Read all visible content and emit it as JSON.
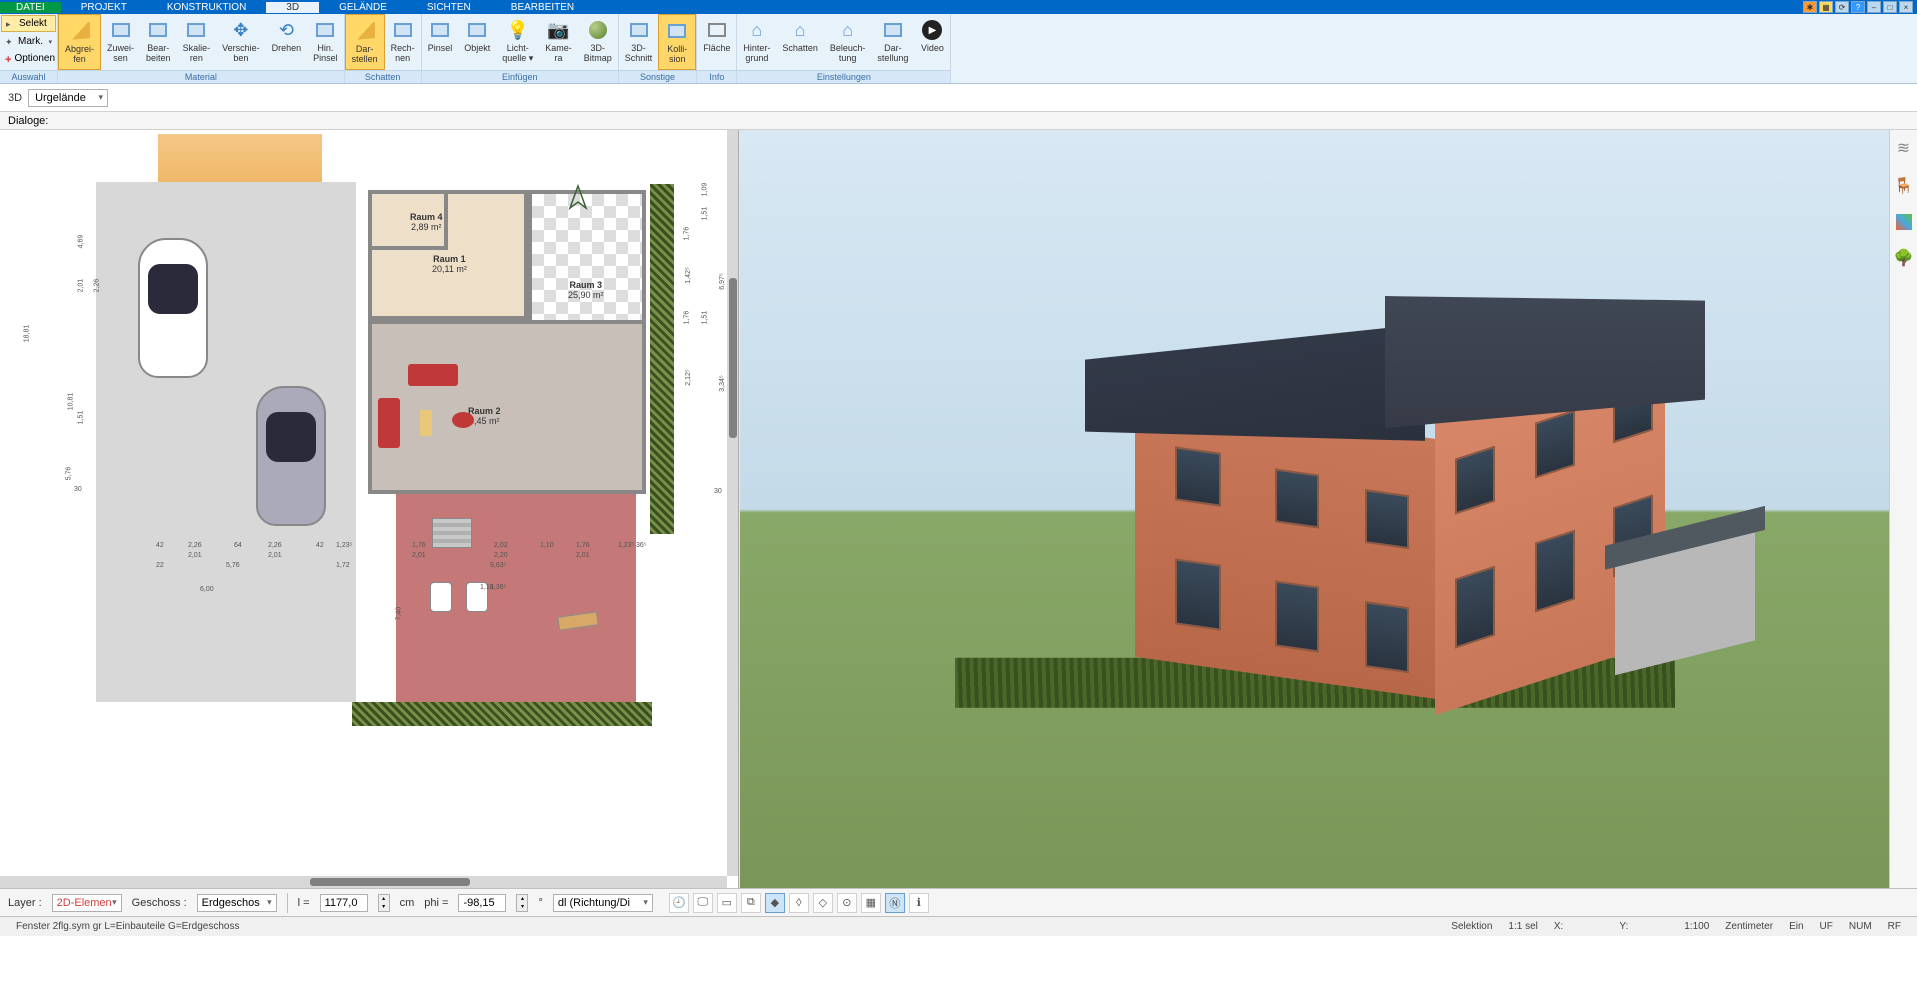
{
  "menu": {
    "tabs": [
      "DATEI",
      "PROJEKT",
      "KONSTRUKTION",
      "3D",
      "GELÄNDE",
      "SICHTEN",
      "BEARBEITEN"
    ],
    "active_index": 3
  },
  "ribbon_left": {
    "selekt": "Selekt",
    "mark": "Mark.",
    "optionen": "Optionen",
    "group": "Auswahl"
  },
  "ribbon_groups": [
    {
      "name": "Material",
      "buttons": [
        {
          "id": "abgreifen",
          "line1": "Abgrei-",
          "line2": "fen",
          "icon": "cube",
          "active": true
        },
        {
          "id": "zuweisen",
          "line1": "Zuwei-",
          "line2": "sen",
          "icon": "box"
        },
        {
          "id": "bearbeiten",
          "line1": "Bear-",
          "line2": "beiten",
          "icon": "box"
        },
        {
          "id": "skalieren",
          "line1": "Skalie-",
          "line2": "ren",
          "icon": "box"
        },
        {
          "id": "verschieben",
          "line1": "Verschie-",
          "line2": "ben",
          "icon": "arrows"
        },
        {
          "id": "drehen",
          "line1": "Drehen",
          "line2": "",
          "icon": "rotate"
        },
        {
          "id": "hinpinsel",
          "line1": "Hin.",
          "line2": "Pinsel",
          "icon": "box"
        }
      ]
    },
    {
      "name": "Schatten",
      "buttons": [
        {
          "id": "darstellen",
          "line1": "Dar-",
          "line2": "stellen",
          "icon": "cube",
          "active": true
        },
        {
          "id": "rechnen",
          "line1": "Rech-",
          "line2": "nen",
          "icon": "box"
        }
      ]
    },
    {
      "name": "Einfügen",
      "buttons": [
        {
          "id": "pinsel",
          "line1": "Pinsel",
          "line2": "",
          "icon": "box"
        },
        {
          "id": "objekt",
          "line1": "Objekt",
          "line2": "",
          "icon": "box"
        },
        {
          "id": "licht",
          "line1": "Licht-",
          "line2": "quelle ▾",
          "icon": "light"
        },
        {
          "id": "kamera",
          "line1": "Kame-",
          "line2": "ra",
          "icon": "camera"
        },
        {
          "id": "bitmap",
          "line1": "3D-",
          "line2": "Bitmap",
          "icon": "sphere"
        }
      ]
    },
    {
      "name": "Sonstige",
      "buttons": [
        {
          "id": "schnitt",
          "line1": "3D-",
          "line2": "Schnitt",
          "icon": "box"
        },
        {
          "id": "kollision",
          "line1": "Kolli-",
          "line2": "sion",
          "icon": "box",
          "active": true
        }
      ]
    },
    {
      "name": "Info",
      "buttons": [
        {
          "id": "flaeche",
          "line1": "Fläche",
          "line2": "",
          "icon": "rect"
        }
      ]
    },
    {
      "name": "Einstellungen",
      "buttons": [
        {
          "id": "hintergrund",
          "line1": "Hinter-",
          "line2": "grund",
          "icon": "house"
        },
        {
          "id": "schatten2",
          "line1": "Schatten",
          "line2": "",
          "icon": "house"
        },
        {
          "id": "beleuchtung",
          "line1": "Beleuch-",
          "line2": "tung",
          "icon": "house"
        },
        {
          "id": "darstellung",
          "line1": "Dar-",
          "line2": "stellung",
          "icon": "box"
        },
        {
          "id": "video",
          "line1": "Video",
          "line2": "",
          "icon": "play"
        }
      ]
    }
  ],
  "subribbon": {
    "label_3d": "3D",
    "terrain_selected": "Urgelände"
  },
  "dialog_label": "Dialoge:",
  "rooms": {
    "r1": {
      "name": "Raum 1",
      "area": "20,11 m²"
    },
    "r2": {
      "name": "Raum 2",
      "area": "6,45 m²"
    },
    "r3": {
      "name": "Raum 3",
      "area": "25,90 m²"
    },
    "r4": {
      "name": "Raum 4",
      "area": "2,89 m²"
    }
  },
  "dimensions": {
    "d_left_total": "18,81",
    "d_left_a": "10,81",
    "d_left_b": "5,76",
    "d_h1": "4,69",
    "d_h2": "2,01",
    "d_h2b": "2,26",
    "d_h3": "1,51",
    "d_h4": "30",
    "d_bot_a": "42",
    "d_bot_b": "2,26",
    "d_bot_b2": "2,01",
    "d_bot_c": "64",
    "d_bot_d": "2,26",
    "d_bot_d2": "2,01",
    "d_bot_e": "42",
    "d_bot_f": "1,23⁵",
    "d_bot_inner1": "22",
    "d_bot_inner2": "5,76",
    "d_bot_inner3": "1,72",
    "d_bot_total": "6,00",
    "d_lower_a": "1,76",
    "d_lower_a2": "2,01",
    "d_lower_b": "2,02",
    "d_lower_b2": "2,20",
    "d_lower_c": "1,10",
    "d_lower_d": "1,76",
    "d_lower_d2": "2,01",
    "d_lower_e": "1,23⁵",
    "d_lower_total": "9,63⁵",
    "d_lower_sub1": "1,10",
    "d_lower_sub2": "1,36⁵",
    "d_lower_left": "7,40",
    "d_right_a": "1,76",
    "d_right_b": "1,42⁵",
    "d_right_c": "1,76",
    "d_right_d": "1,51",
    "d_right_d2": "1,51",
    "d_right_e": "2,12⁵",
    "d_right_e2": "1,09",
    "d_right_total": "6,97⁵",
    "d_right_total2": "3,34⁵",
    "d_right_end": "30",
    "d_right_end2": "36⁵"
  },
  "bottombar": {
    "layer_label": "Layer :",
    "layer_value": "2D-Elemen",
    "geschoss_label": "Geschoss :",
    "geschoss_value": "Erdgeschos",
    "l_label": "l =",
    "l_value": "1177,0",
    "l_unit": "cm",
    "phi_label": "phi =",
    "phi_value": "-98,15",
    "dl_value": "dl (Richtung/Di"
  },
  "statusbar": {
    "left": "Fenster 2flg.sym gr L=Einbauteile G=Erdgeschoss",
    "selektion": "Selektion",
    "sel_ratio": "1:1 sel",
    "x_label": "X:",
    "y_label": "Y:",
    "scale": "1:100",
    "unit": "Zentimeter",
    "ein": "Ein",
    "uf": "UF",
    "num": "NUM",
    "rf": "RF"
  }
}
